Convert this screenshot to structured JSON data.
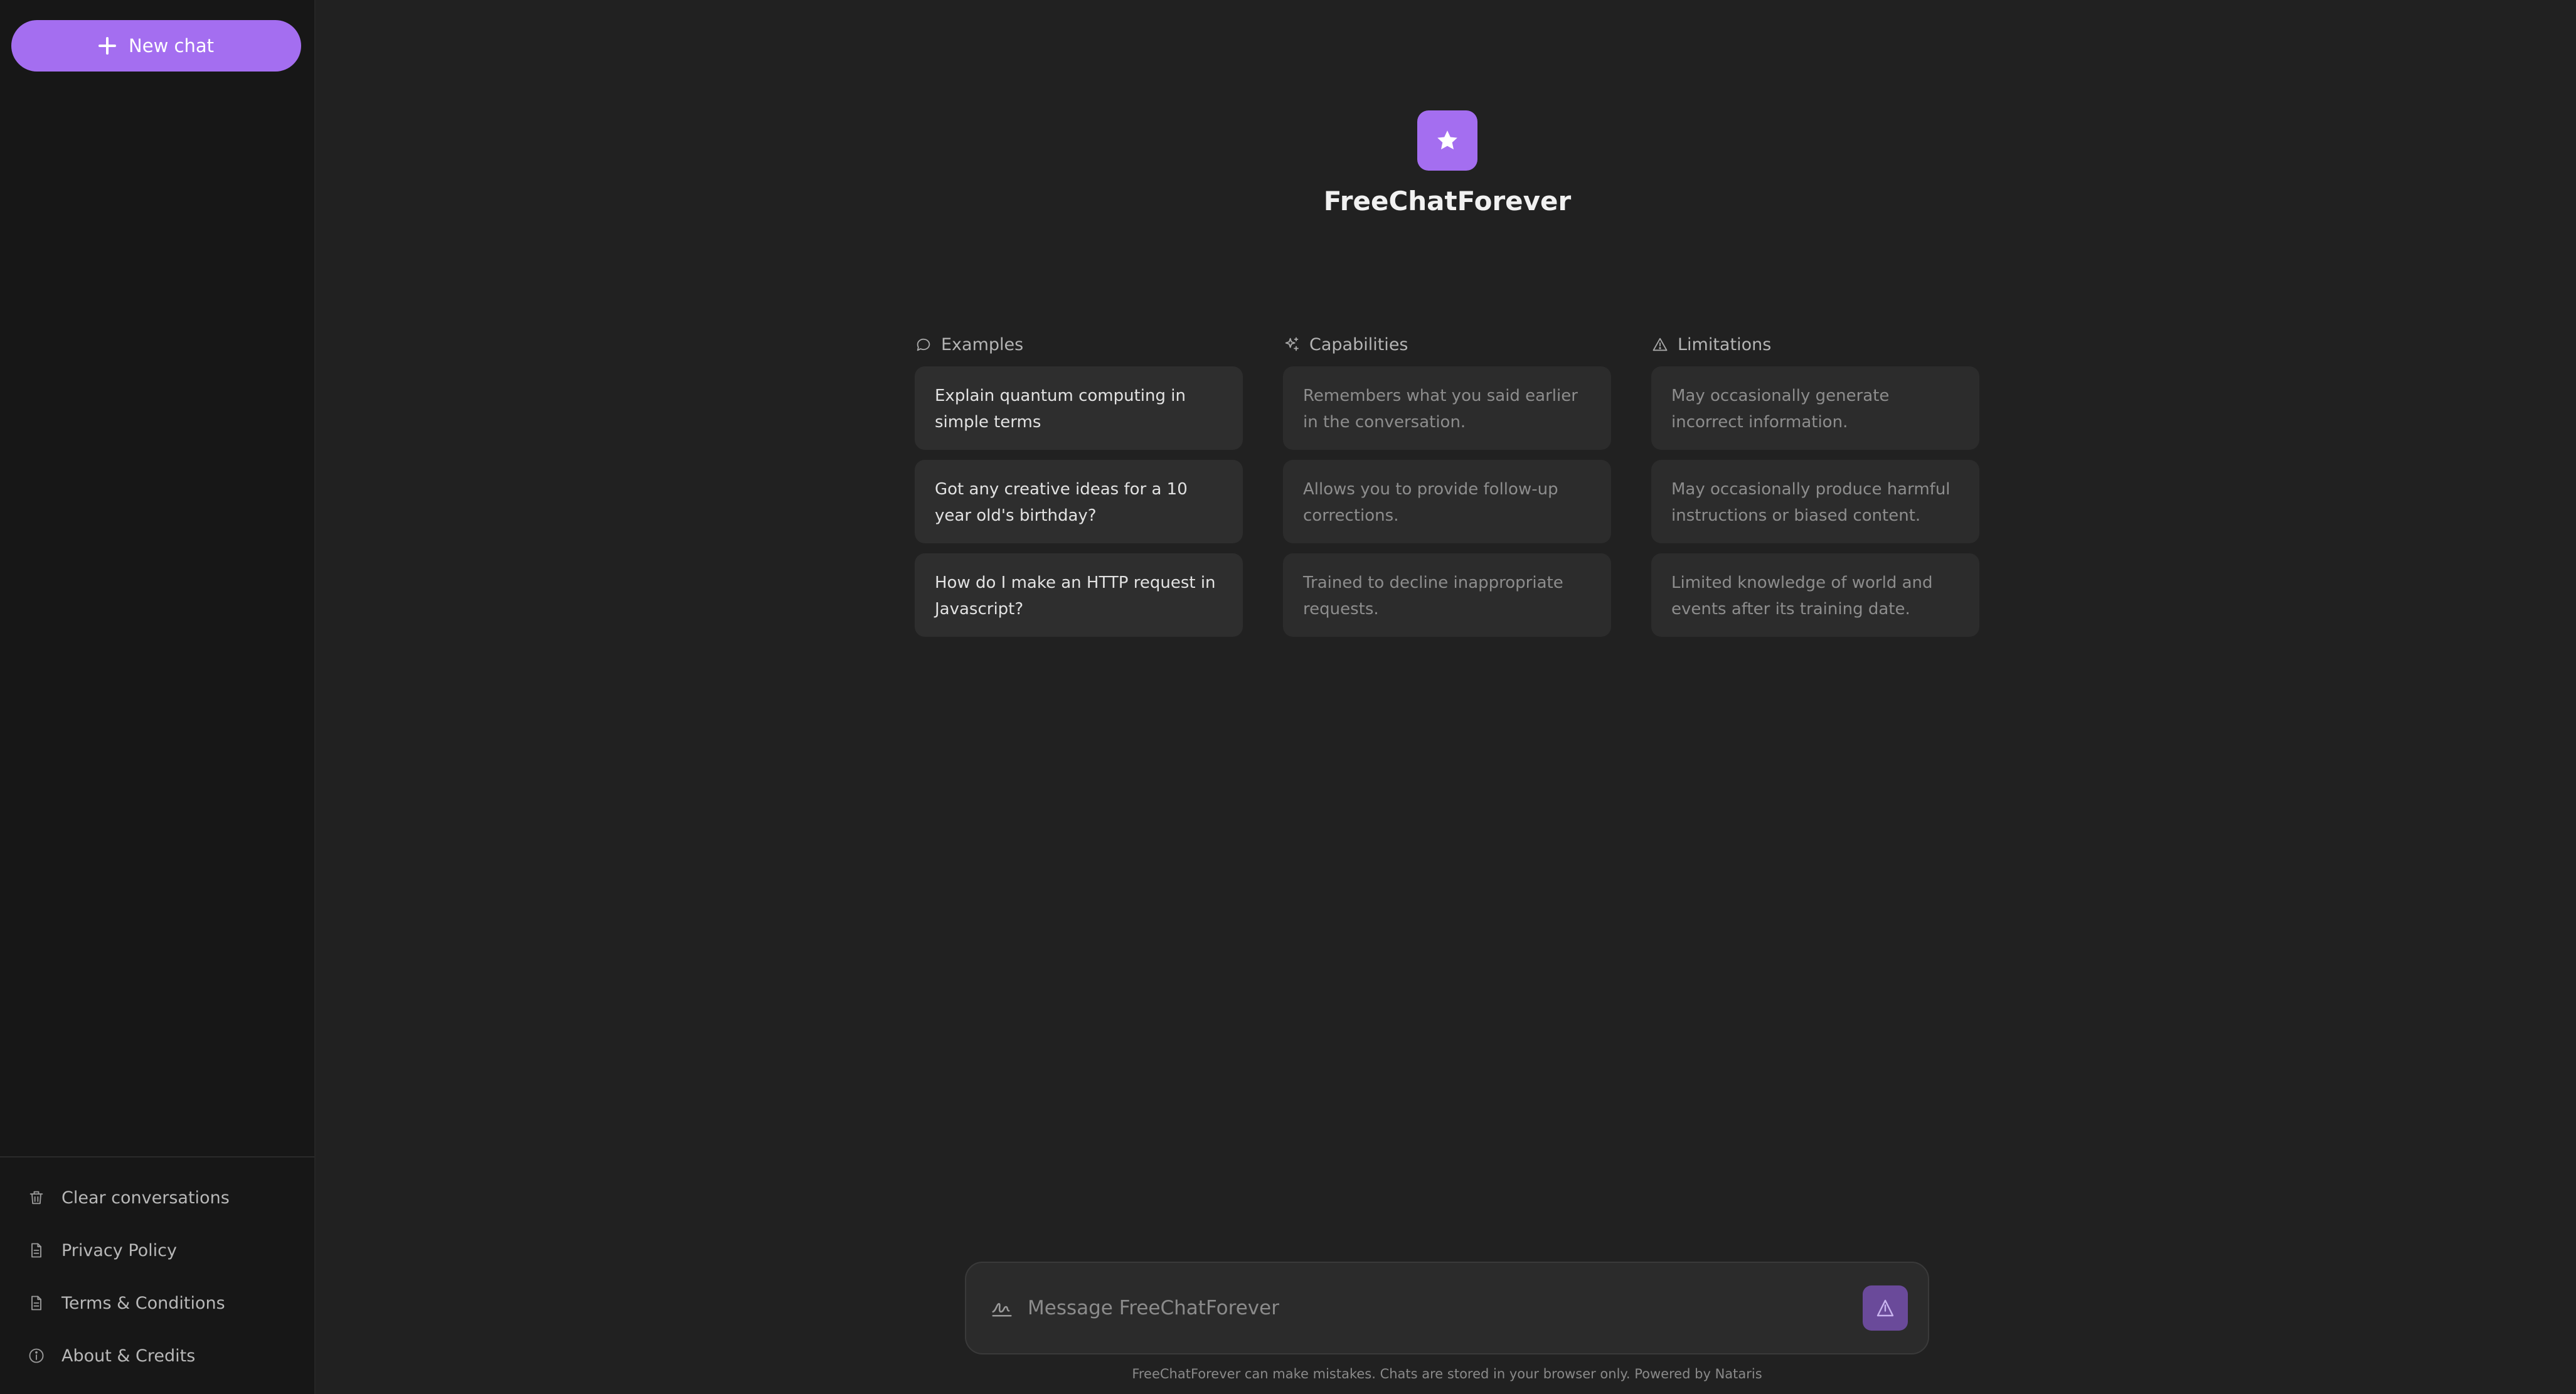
{
  "sidebar": {
    "new_chat_label": "New chat",
    "bottom_items": [
      {
        "label": "Clear conversations",
        "icon": "trash-icon"
      },
      {
        "label": "Privacy Policy",
        "icon": "document-icon"
      },
      {
        "label": "Terms & Conditions",
        "icon": "document-icon"
      },
      {
        "label": "About & Credits",
        "icon": "info-icon"
      }
    ]
  },
  "main": {
    "brand_name": "FreeChatForever",
    "logo_icon": "star-icon",
    "columns": [
      {
        "heading": "Examples",
        "icon": "chat-bubble-icon",
        "cards": [
          "Explain quantum computing in simple terms",
          "Got any creative ideas for a 10 year old's birthday?",
          "How do I make an HTTP request in Javascript?"
        ]
      },
      {
        "heading": "Capabilities",
        "icon": "sparkles-icon",
        "cards": [
          "Remembers what you said earlier in the conversation.",
          "Allows you to provide follow-up corrections.",
          "Trained to decline inappropriate requests."
        ]
      },
      {
        "heading": "Limitations",
        "icon": "warning-icon",
        "cards": [
          "May occasionally generate incorrect information.",
          "May occasionally produce harmful instructions or biased content.",
          "Limited knowledge of world and events after its training date."
        ]
      }
    ]
  },
  "composer": {
    "placeholder": "Message FreeChatForever",
    "value": "",
    "footnote": "FreeChatForever can make mistakes. Chats are stored in your browser only. Powered by Nataris"
  },
  "colors": {
    "accent": "#a46ef0",
    "background": "#212121",
    "sidebar": "#171717",
    "card": "#2c2c2c"
  }
}
